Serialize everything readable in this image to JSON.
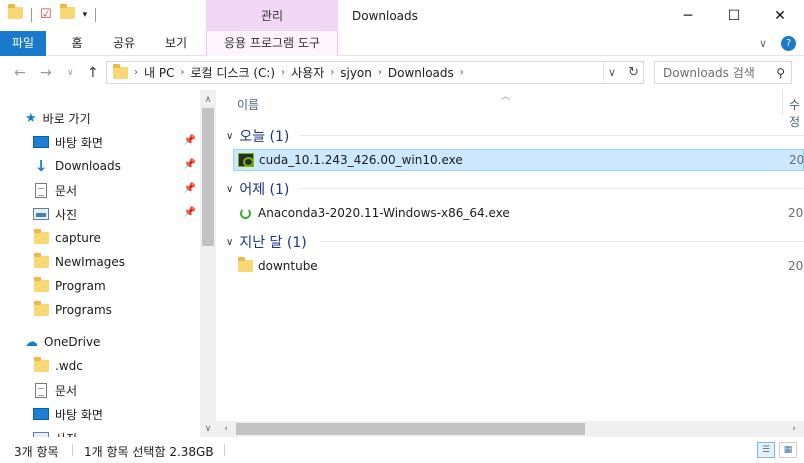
{
  "window": {
    "title": "Downloads",
    "context_tab_header": "관리",
    "controls": {
      "minimize": "─",
      "maximize": "☐",
      "close": "✕"
    }
  },
  "ribbon": {
    "tabs": [
      {
        "label": "파일"
      },
      {
        "label": "홈"
      },
      {
        "label": "공유"
      },
      {
        "label": "보기"
      },
      {
        "label": "응용 프로그램 도구"
      }
    ]
  },
  "address": {
    "crumbs": [
      "내 PC",
      "로컬 디스크 (C:)",
      "사용자",
      "sjyon",
      "Downloads"
    ]
  },
  "search": {
    "placeholder": "Downloads 검색"
  },
  "nav_pane": {
    "quick_access_label": "바로 가기",
    "quick_items": [
      {
        "label": "바탕 화면",
        "icon": "desktop-icon",
        "pinned": true
      },
      {
        "label": "Downloads",
        "icon": "download-icon",
        "pinned": true
      },
      {
        "label": "문서",
        "icon": "document-icon",
        "pinned": true
      },
      {
        "label": "사진",
        "icon": "pictures-icon",
        "pinned": true
      },
      {
        "label": "capture",
        "icon": "folder-icon",
        "pinned": false
      },
      {
        "label": "NewImages",
        "icon": "folder-icon",
        "pinned": false
      },
      {
        "label": "Program",
        "icon": "folder-icon",
        "pinned": false
      },
      {
        "label": "Programs",
        "icon": "folder-icon",
        "pinned": false
      }
    ],
    "onedrive_label": "OneDrive",
    "onedrive_items": [
      {
        "label": ".wdc",
        "icon": "folder-icon"
      },
      {
        "label": "문서",
        "icon": "document-icon"
      },
      {
        "label": "바탕 화면",
        "icon": "desktop-icon"
      },
      {
        "label": "사진",
        "icon": "pictures-icon"
      }
    ]
  },
  "content": {
    "columns": {
      "name": "이름",
      "date": "수정"
    },
    "groups": [
      {
        "label": "오늘 (1)",
        "files": [
          {
            "name": "cuda_10.1.243_426.00_win10.exe",
            "date": "20",
            "icon": "nvidia-installer-icon",
            "selected": true
          }
        ]
      },
      {
        "label": "어제 (1)",
        "files": [
          {
            "name": "Anaconda3-2020.11-Windows-x86_64.exe",
            "date": "20",
            "icon": "anaconda-icon",
            "selected": false
          }
        ]
      },
      {
        "label": "지난 달 (1)",
        "files": [
          {
            "name": "downtube",
            "date": "20",
            "icon": "folder-icon",
            "selected": false
          }
        ]
      }
    ]
  },
  "status": {
    "item_count": "3개 항목",
    "selection": "1개 항목 선택함 2.38GB"
  }
}
